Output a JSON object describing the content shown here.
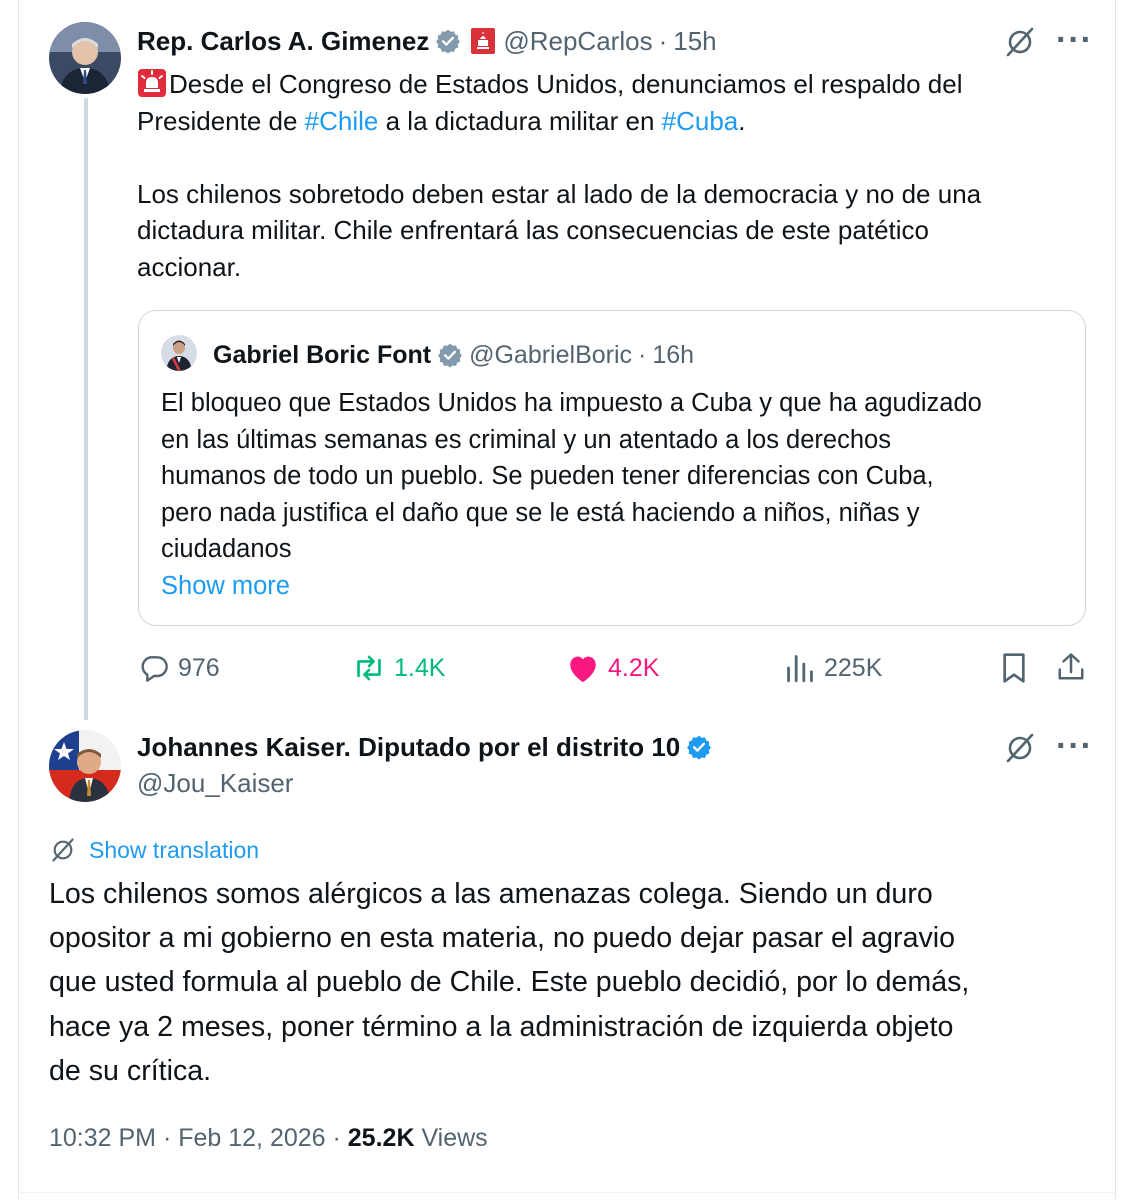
{
  "tweet1": {
    "author": "Rep. Carlos A. Gimenez",
    "handle": "@RepCarlos",
    "sep": "·",
    "time": "15h",
    "text_seg1": "Desde el Congreso de Estados Unidos, denunciamos el respaldo del",
    "text_seg2": "Presidente de ",
    "hashtag1": "#Chile",
    "text_seg3": " a la dictadura militar en ",
    "hashtag2": "#Cuba",
    "text_seg4": ".",
    "para2_line1": "Los chilenos sobretodo deben estar al lado de la democracia y no de una",
    "para2_line2": "dictadura  militar. Chile enfrentará las consecuencias de este patético",
    "para2_line3": "accionar.",
    "quote": {
      "author": "Gabriel Boric Font",
      "handle": "@GabrielBoric",
      "sep": "·",
      "time": "16h",
      "line1": "El bloqueo que Estados Unidos ha impuesto a Cuba y que ha agudizado",
      "line2": "en las últimas semanas es criminal y un atentado a los derechos",
      "line3": "humanos de todo un pueblo. Se pueden tener diferencias con Cuba,",
      "line4": "pero nada justifica el daño que se le está haciendo a niños, niñas y",
      "line5": "ciudadanos",
      "show_more": "Show more"
    },
    "actions": {
      "replies": "976",
      "reposts": "1.4K",
      "likes": "4.2K",
      "views": "225K"
    }
  },
  "tweet2": {
    "author": "Johannes Kaiser. Diputado por el distrito 10",
    "handle": "@Jou_Kaiser",
    "show_translation": "Show translation",
    "line1": "Los chilenos somos alérgicos a las amenazas colega.  Siendo un duro",
    "line2": "opositor a mi gobierno en esta materia, no puedo dejar pasar el agravio",
    "line3": "que usted formula al pueblo de Chile.  Este pueblo decidió, por lo demás,",
    "line4": "hace ya 2 meses, poner término a la administración de izquierda objeto",
    "line5": "de su crítica.",
    "timestamp": "10:32 PM · Feb 12, 2026 · ",
    "views_count": "25.2K",
    "views_label": " Views"
  },
  "colors": {
    "accent": "#1d9bf0",
    "like": "#f91880",
    "repost": "#00ba7c",
    "muted": "#536471",
    "border": "#cfd9de"
  },
  "icons": [
    "siren-icon",
    "capitol-flag-icon",
    "verified-badge-icon",
    "grok-icon",
    "more-icon",
    "reply-icon",
    "repost-icon",
    "like-icon",
    "views-icon",
    "bookmark-icon",
    "share-icon",
    "translate-icon"
  ]
}
